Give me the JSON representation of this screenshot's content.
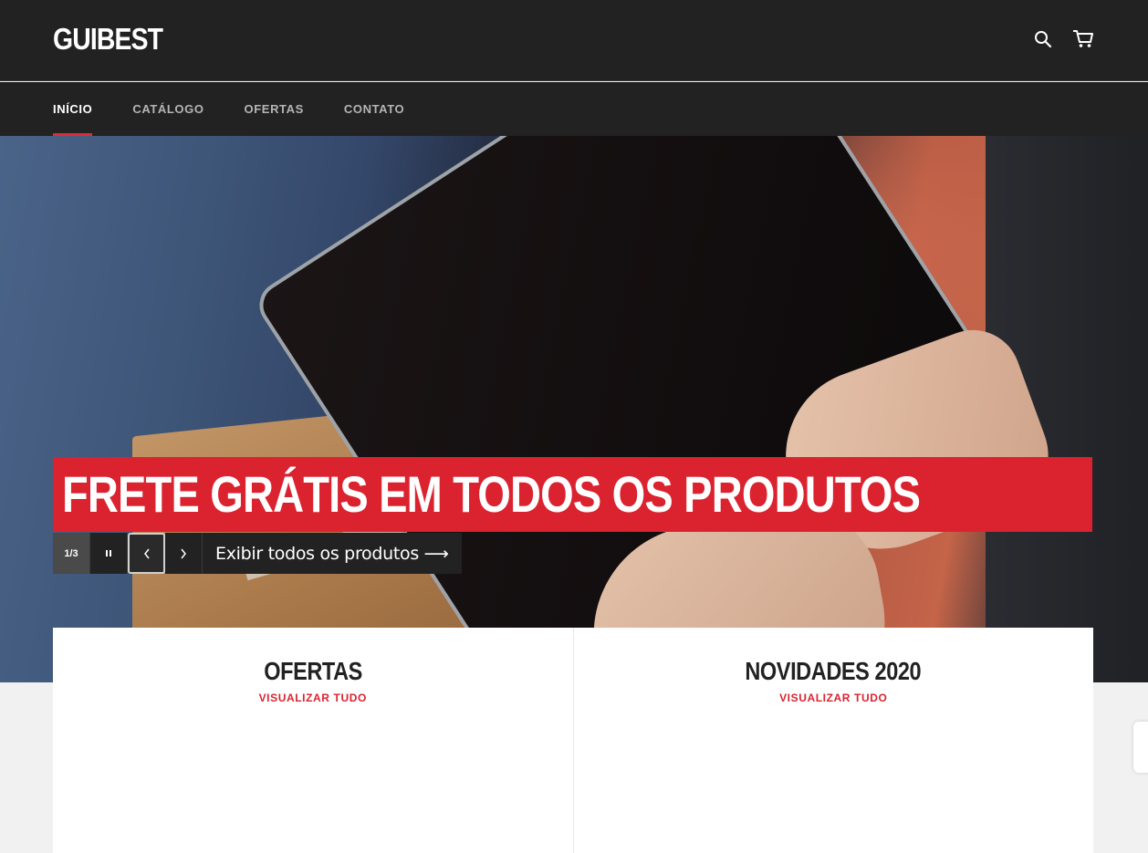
{
  "header": {
    "logo": "GUIBEST",
    "icons": [
      "search-icon",
      "cart-icon"
    ]
  },
  "nav": {
    "items": [
      {
        "label": "INÍCIO",
        "active": true
      },
      {
        "label": "CATÁLOGO",
        "active": false
      },
      {
        "label": "OFERTAS",
        "active": false
      },
      {
        "label": "CONTATO",
        "active": false
      }
    ]
  },
  "hero": {
    "title": "FRETE GRÁTIS EM TODOS OS PRODUTOS",
    "counter": "1/3",
    "pause_icon": "pause-icon",
    "prev_icon": "chevron-left-icon",
    "next_icon": "chevron-right-icon",
    "cta": "Exibir todos os produtos ⟶"
  },
  "collections": [
    {
      "title": "OFERTAS",
      "link": "VISUALIZAR TUDO"
    },
    {
      "title": "NOVIDADES 2020",
      "link": "VISUALIZAR TUDO"
    }
  ],
  "colors": {
    "header_bg": "#222222",
    "accent": "#db2330",
    "page_bg": "#f1f1f1"
  }
}
